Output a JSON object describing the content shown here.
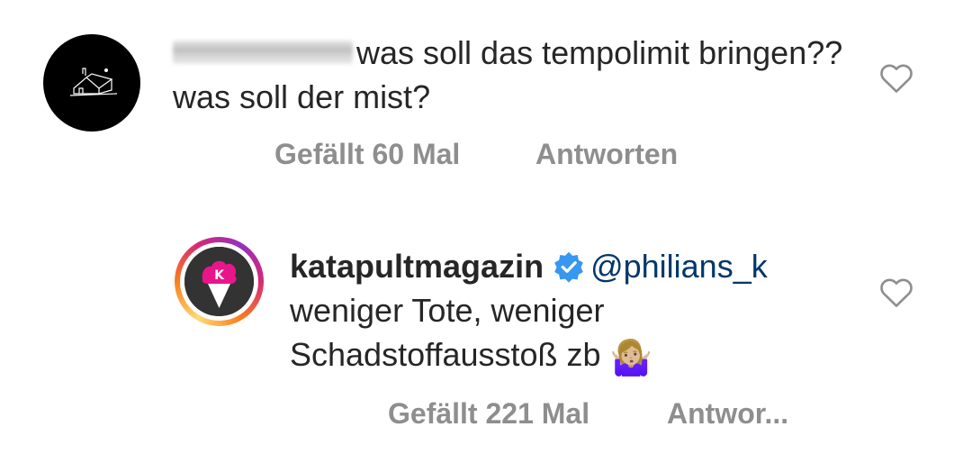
{
  "comment1": {
    "text": "was soll das tempolimit bringen?? was soll der mist?",
    "likes_label": "Gefällt 60 Mal",
    "reply_label": "Antworten"
  },
  "comment2": {
    "username": "katapultmagazin",
    "mention": "@philians_k",
    "text": "weniger Tote, weniger Schadstoffausstoß zb",
    "emoji": "🤷🏼‍♀️",
    "likes_label": "Gefällt 221 Mal",
    "reply_label": "Antwor..."
  },
  "icons": {
    "like": "heart-outline-icon",
    "verified": "verified-badge-icon"
  },
  "colors": {
    "mention": "#00376b",
    "verified": "#3897f0",
    "meta": "#8e8e8e",
    "story_ring_start": "#feda75",
    "story_ring_end": "#d62976"
  }
}
